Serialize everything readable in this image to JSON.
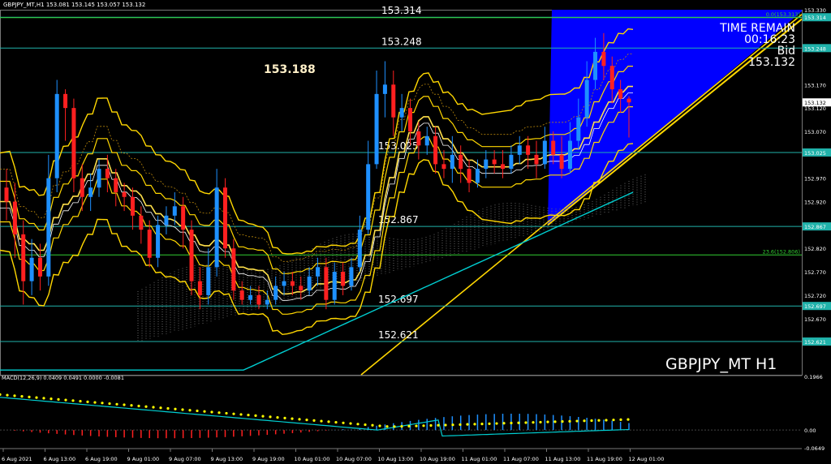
{
  "symbol_header": "GBPJPY_MT,H1  153.081 153.145 153.057 153.132",
  "symbol_label": "GBPJPY_MT H1",
  "countdown": {
    "title": "TIME REMAIN",
    "time": "00:16:23",
    "bid_label": "Bid",
    "bid_value": "153.132"
  },
  "macd_label": "MACD(12,26,9) 0.0409 0.0491 0.0000 -0.0081",
  "level_labels": [
    {
      "text": "153.314",
      "price": 153.314
    },
    {
      "text": "153.248",
      "price": 153.248
    },
    {
      "text": "153.188",
      "price": 153.188
    },
    {
      "text": "153.025",
      "price": 153.025
    },
    {
      "text": "152.867",
      "price": 152.867
    },
    {
      "text": "152.697",
      "price": 152.697
    },
    {
      "text": "152.621",
      "price": 152.621
    }
  ],
  "fib_labels": [
    {
      "text": "0.0(153.313)",
      "price": 153.313
    },
    {
      "text": "23.6(152.806)",
      "price": 152.806
    }
  ],
  "colors": {
    "up": "#1e90ff",
    "down": "#ff2020",
    "hline": "#20b2aa",
    "fib": "#32cd32",
    "bands": "#ffd700",
    "ma_cyan": "#00ced1",
    "triangle": "#0000ff",
    "macd_signal": "#ffff00"
  },
  "chart_data": [
    {
      "type": "candlestick",
      "title": "GBPJPY_MT H1",
      "ylim": [
        152.55,
        153.33
      ],
      "y_ticks": [
        "153.330",
        "153.314",
        "153.248",
        "153.170",
        "153.132",
        "153.120",
        "153.070",
        "153.025",
        "152.970",
        "152.920",
        "152.867",
        "152.820",
        "152.770",
        "152.720",
        "152.697",
        "152.670",
        "152.621"
      ],
      "price_tags": [
        153.314,
        153.248,
        153.132,
        153.025,
        152.867,
        152.697,
        152.621
      ],
      "x_labels": [
        "6 Aug 2021",
        "6 Aug 13:00",
        "6 Aug 19:00",
        "9 Aug 01:00",
        "9 Aug 07:00",
        "9 Aug 13:00",
        "9 Aug 19:00",
        "10 Aug 01:00",
        "10 Aug 07:00",
        "10 Aug 13:00",
        "10 Aug 19:00",
        "11 Aug 01:00",
        "11 Aug 07:00",
        "11 Aug 13:00",
        "11 Aug 19:00",
        "12 Aug 01:00"
      ],
      "candles": [
        [
          152.95,
          152.92,
          152.99,
          152.88
        ],
        [
          152.92,
          152.85,
          152.96,
          152.8
        ],
        [
          152.85,
          152.75,
          152.88,
          152.7
        ],
        [
          152.75,
          152.8,
          152.84,
          152.72
        ],
        [
          152.8,
          152.76,
          152.83,
          152.73
        ],
        [
          152.76,
          152.97,
          153.02,
          152.74
        ],
        [
          152.97,
          153.15,
          153.18,
          152.94
        ],
        [
          153.15,
          153.12,
          153.16,
          153.05
        ],
        [
          153.12,
          152.97,
          153.14,
          152.94
        ],
        [
          152.97,
          152.93,
          153.0,
          152.9
        ],
        [
          152.93,
          152.95,
          152.98,
          152.9
        ],
        [
          152.95,
          152.99,
          153.01,
          152.93
        ],
        [
          152.99,
          152.97,
          153.02,
          152.94
        ],
        [
          152.97,
          152.94,
          152.99,
          152.91
        ],
        [
          152.94,
          152.93,
          152.96,
          152.9
        ],
        [
          152.93,
          152.89,
          152.95,
          152.86
        ],
        [
          152.89,
          152.86,
          152.91,
          152.83
        ],
        [
          152.86,
          152.8,
          152.88,
          152.78
        ],
        [
          152.8,
          152.87,
          152.89,
          152.78
        ],
        [
          152.87,
          152.89,
          152.91,
          152.85
        ],
        [
          152.89,
          152.91,
          152.94,
          152.87
        ],
        [
          152.91,
          152.86,
          152.93,
          152.82
        ],
        [
          152.86,
          152.75,
          152.88,
          152.72
        ],
        [
          152.75,
          152.72,
          152.78,
          152.69
        ],
        [
          152.72,
          152.78,
          152.82,
          152.7
        ],
        [
          152.78,
          152.95,
          152.99,
          152.76
        ],
        [
          152.95,
          152.82,
          152.97,
          152.8
        ],
        [
          152.82,
          152.73,
          152.84,
          152.71
        ],
        [
          152.73,
          152.71,
          152.75,
          152.7
        ],
        [
          152.71,
          152.72,
          152.74,
          152.7
        ],
        [
          152.72,
          152.7,
          152.74,
          152.69
        ],
        [
          152.7,
          152.71,
          152.73,
          152.69
        ],
        [
          152.71,
          152.74,
          152.76,
          152.7
        ],
        [
          152.74,
          152.75,
          152.77,
          152.72
        ],
        [
          152.75,
          152.74,
          152.77,
          152.72
        ],
        [
          152.74,
          152.73,
          152.76,
          152.71
        ],
        [
          152.73,
          152.76,
          152.78,
          152.72
        ],
        [
          152.76,
          152.78,
          152.8,
          152.74
        ],
        [
          152.78,
          152.71,
          152.8,
          152.69
        ],
        [
          152.71,
          152.77,
          152.79,
          152.7
        ],
        [
          152.77,
          152.74,
          152.79,
          152.72
        ],
        [
          152.74,
          152.78,
          152.8,
          152.73
        ],
        [
          152.78,
          152.86,
          152.89,
          152.77
        ],
        [
          152.86,
          153.0,
          153.05,
          152.85
        ],
        [
          153.0,
          153.15,
          153.2,
          152.99
        ],
        [
          153.15,
          153.17,
          153.22,
          153.1
        ],
        [
          153.17,
          153.1,
          153.2,
          153.06
        ],
        [
          153.1,
          153.12,
          153.15,
          153.07
        ],
        [
          153.12,
          153.07,
          153.14,
          153.04
        ],
        [
          153.07,
          153.04,
          153.09,
          153.01
        ],
        [
          153.04,
          153.06,
          153.08,
          153.02
        ],
        [
          153.06,
          153.0,
          153.08,
          152.98
        ],
        [
          153.0,
          152.99,
          153.03,
          152.97
        ],
        [
          152.99,
          153.02,
          153.06,
          152.96
        ],
        [
          153.02,
          152.99,
          153.04,
          152.96
        ],
        [
          152.99,
          152.96,
          153.01,
          152.94
        ],
        [
          152.96,
          152.99,
          153.01,
          152.95
        ],
        [
          152.99,
          153.01,
          153.03,
          152.97
        ],
        [
          153.01,
          153.0,
          153.03,
          152.98
        ],
        [
          153.0,
          152.99,
          153.03,
          152.97
        ],
        [
          152.99,
          153.02,
          153.04,
          152.98
        ],
        [
          153.02,
          153.04,
          153.06,
          153.0
        ],
        [
          153.04,
          153.02,
          153.06,
          152.99
        ],
        [
          153.02,
          153.0,
          153.05,
          152.97
        ],
        [
          153.0,
          153.05,
          153.08,
          152.99
        ],
        [
          153.05,
          153.02,
          153.07,
          153.0
        ],
        [
          153.02,
          152.99,
          153.06,
          152.97
        ],
        [
          152.99,
          153.05,
          153.09,
          152.98
        ],
        [
          153.05,
          153.1,
          153.14,
          153.03
        ],
        [
          153.1,
          153.18,
          153.22,
          153.08
        ],
        [
          153.18,
          153.24,
          153.27,
          153.16
        ],
        [
          153.24,
          153.21,
          153.28,
          153.18
        ],
        [
          153.21,
          153.16,
          153.23,
          153.13
        ],
        [
          153.16,
          153.14,
          153.18,
          153.11
        ],
        [
          153.14,
          153.132,
          153.145,
          153.057
        ]
      ]
    },
    {
      "type": "bar",
      "title": "MACD(12,26,9)",
      "ylim": [
        -0.0649,
        0.1966
      ],
      "y_ticks": [
        "0.1966",
        "0.00",
        "-0.0649"
      ]
    }
  ]
}
